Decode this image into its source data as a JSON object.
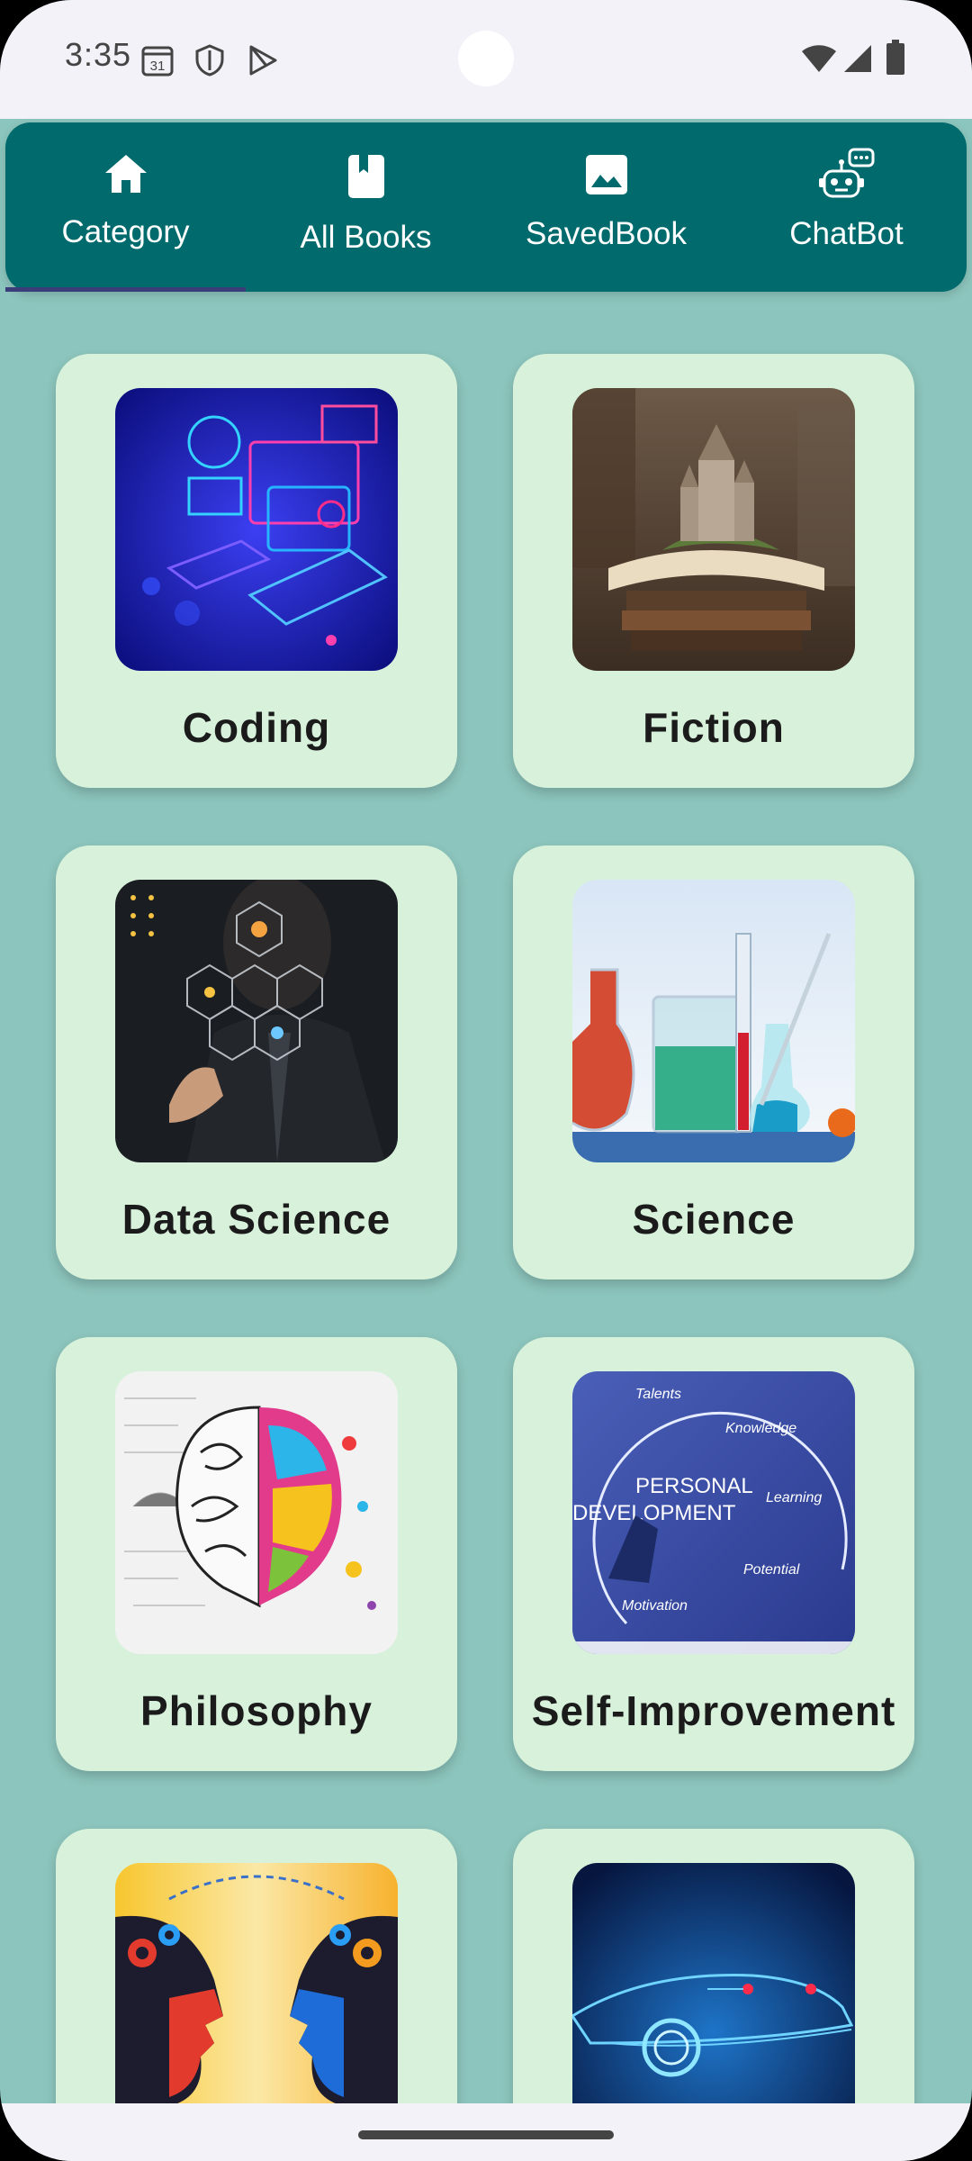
{
  "status_bar": {
    "time": "3:35",
    "icons": [
      "calendar-31-icon",
      "shield-icon",
      "play-store-icon",
      "wifi-icon",
      "signal-icon",
      "battery-icon"
    ],
    "calendar_day": "31"
  },
  "tabs": [
    {
      "label": "Category",
      "icon": "home-icon",
      "selected": true
    },
    {
      "label": "All Books",
      "icon": "book-icon",
      "selected": false
    },
    {
      "label": "SavedBook",
      "icon": "image-icon",
      "selected": false
    },
    {
      "label": "ChatBot",
      "icon": "robot-chat-icon",
      "selected": false
    }
  ],
  "categories": [
    {
      "label": "Coding",
      "image": "coding-illustration"
    },
    {
      "label": "Fiction",
      "image": "fiction-book-castle"
    },
    {
      "label": "Data Science",
      "image": "data-science-hexagons"
    },
    {
      "label": "Science",
      "image": "science-flasks"
    },
    {
      "label": "Philosophy",
      "image": "philosophy-brain"
    },
    {
      "label": "Self-Improvement",
      "image": "personal-development-board"
    },
    {
      "label": "",
      "image": "psychology-gears-heads"
    },
    {
      "label": "",
      "image": "technology-car"
    }
  ],
  "colors": {
    "background": "#8cc5bd",
    "tab_bar": "#006a6d",
    "card": "#d7f1db",
    "indicator": "#3a3d7a"
  }
}
